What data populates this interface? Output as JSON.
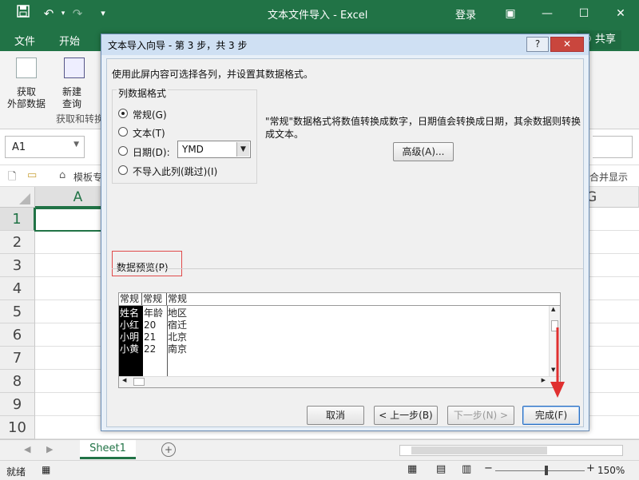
{
  "excel": {
    "title": "文本文件导入 - Excel",
    "login": "登录",
    "share": "共享",
    "tabs": [
      "文件",
      "开始"
    ],
    "ribbon": {
      "get_external": [
        "获取",
        "外部数据"
      ],
      "new_query": [
        "新建",
        "查询"
      ],
      "group_label": "获取和转换"
    },
    "namebox": "A1",
    "favbar_item": "模板专",
    "favbar_right": "合并显示",
    "columns": [
      "A",
      "G"
    ],
    "rows": [
      "1",
      "2",
      "3",
      "4",
      "5",
      "6",
      "7",
      "8",
      "9",
      "10"
    ],
    "sheet_tab": "Sheet1",
    "status": "就绪",
    "zoom": "150%"
  },
  "dialog": {
    "title": "文本导入向导 - 第 3 步，共 3 步",
    "help": "?",
    "close": "✕",
    "instruction": "使用此屏内容可选择各列，并设置其数据格式。",
    "format_group": "列数据格式",
    "options": [
      {
        "label": "常规(G)",
        "selected": true
      },
      {
        "label": "文本(T)",
        "selected": false
      },
      {
        "label": "日期(D):",
        "selected": false
      },
      {
        "label": "不导入此列(跳过)(I)",
        "selected": false
      }
    ],
    "date_format": "YMD",
    "description_line1": "\"常规\"数据格式将数值转换成数字，日期值会转换成日期，其余数据则转换",
    "description_line2": "成文本。",
    "advanced": "高级(A)...",
    "preview_label": "数据预览(P)",
    "preview_headers": [
      "常规",
      "常规",
      "常规"
    ],
    "preview_rows": [
      [
        "姓名",
        "年龄",
        "地区"
      ],
      [
        "小红",
        "20",
        "宿迁"
      ],
      [
        "小明",
        "21",
        "北京"
      ],
      [
        "小黄",
        "22",
        "南京"
      ]
    ],
    "buttons": {
      "cancel": "取消",
      "back": "< 上一步(B)",
      "next": "下一步(N) >",
      "finish": "完成(F)"
    }
  },
  "colors": {
    "excel_green": "#217346",
    "annotation_red": "#e03030"
  }
}
